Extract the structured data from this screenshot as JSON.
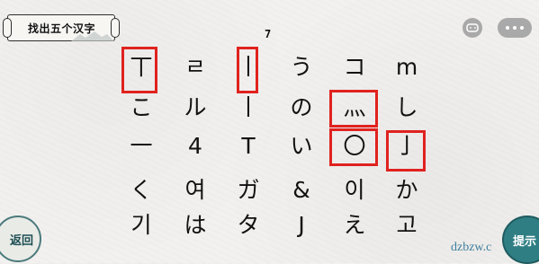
{
  "title": "找出五个汉字",
  "found_count": "7",
  "grid": [
    [
      "丅",
      "ㄹ",
      "丨",
      "う",
      "コ",
      "m"
    ],
    [
      "こ",
      "ル",
      "丨",
      "の",
      "灬",
      "し"
    ],
    [
      "一",
      "4",
      "T",
      "い",
      "〇",
      "亅"
    ],
    [
      "く",
      "여",
      "ガ",
      "&",
      "이",
      "か"
    ],
    [
      "기",
      "は",
      "タ",
      "J",
      "え",
      "고"
    ]
  ],
  "found_cells": [
    [
      0,
      0
    ],
    [
      0,
      2
    ],
    [
      1,
      4
    ],
    [
      2,
      4
    ],
    [
      2,
      5
    ]
  ],
  "buttons": {
    "back": "返回",
    "hint": "提示"
  },
  "icons": {
    "gamepad": "gamepad-icon",
    "more": "more-icon"
  },
  "watermark": "dzbzw.c",
  "colors": {
    "highlight": "#e0221f",
    "accent": "#2f7e83",
    "background": "#f2f1ef"
  }
}
